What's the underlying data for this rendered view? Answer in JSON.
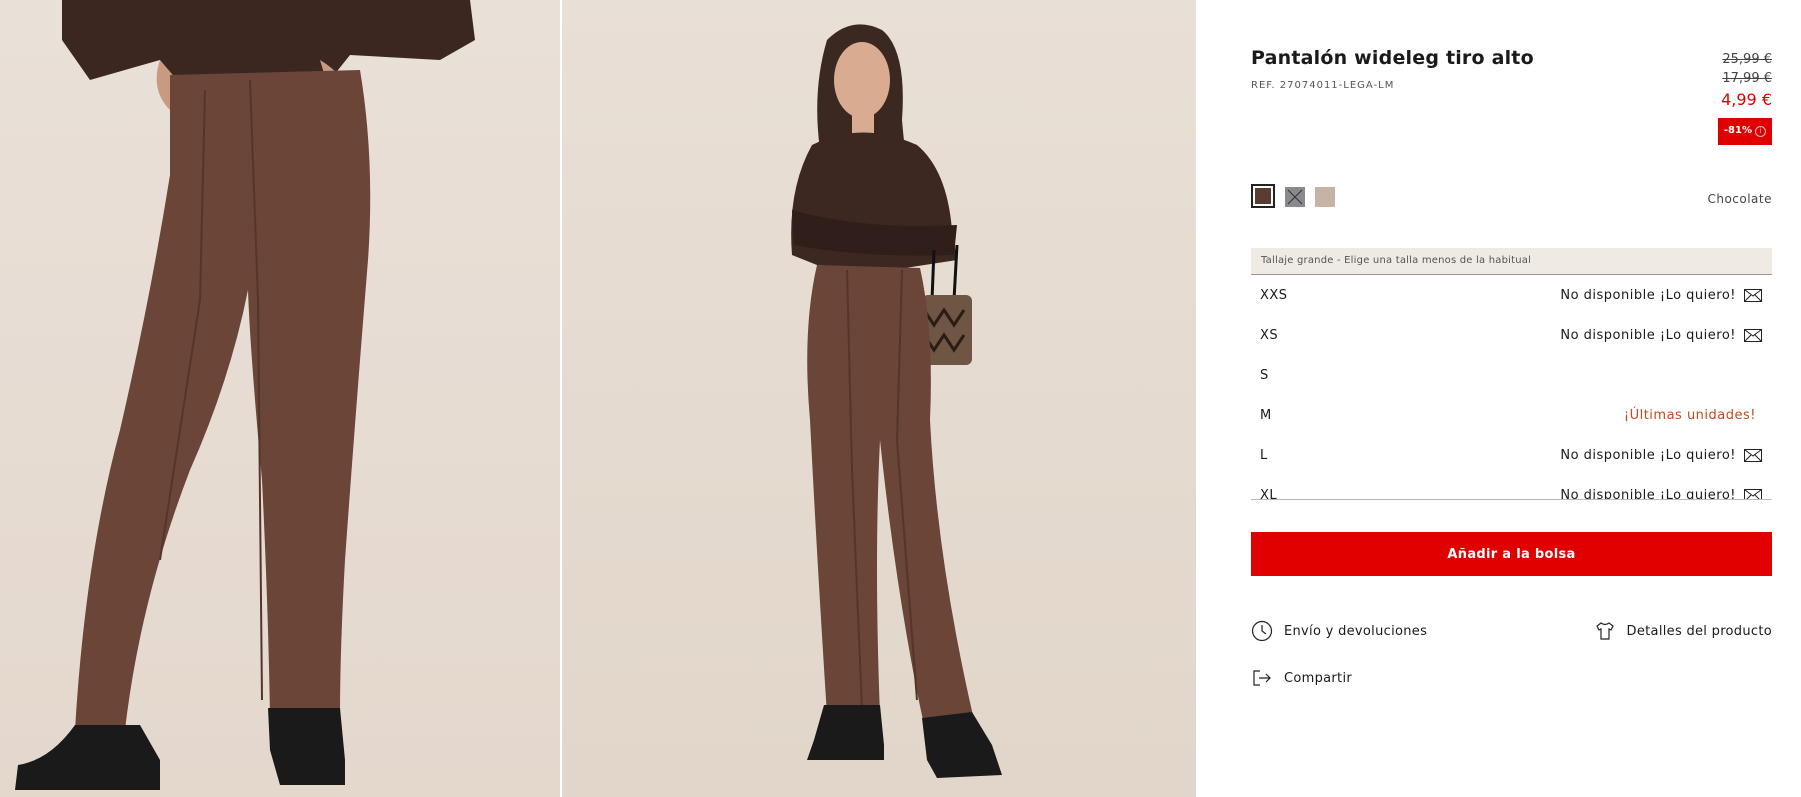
{
  "product": {
    "title": "Pantalón wideleg tiro alto",
    "ref": "REF. 27074011-LEGA-LM",
    "prices": {
      "original": "25,99 €",
      "previous": "17,99 €",
      "current": "4,99 €",
      "discount": "-81%"
    }
  },
  "colors": {
    "selected_name": "Chocolate",
    "swatches": [
      {
        "name": "chocolate",
        "hex": "#5a3c32",
        "available": true,
        "selected": true
      },
      {
        "name": "grey",
        "hex": "#8a8a8e",
        "available": false,
        "selected": false
      },
      {
        "name": "beige",
        "hex": "#c7b3a3",
        "available": true,
        "selected": false
      }
    ]
  },
  "sizes": {
    "note": "Tallaje grande - Elige una talla menos de la habitual",
    "rows": [
      {
        "label": "XXS",
        "status": "No disponible ¡Lo quiero!"
      },
      {
        "label": "XS",
        "status": "No disponible ¡Lo quiero!"
      },
      {
        "label": "S",
        "status": ""
      },
      {
        "label": "M",
        "status": "¡Últimas unidades!"
      },
      {
        "label": "L",
        "status": "No disponible ¡Lo quiero!"
      },
      {
        "label": "XL",
        "status": "No disponible ¡Lo quiero!"
      }
    ]
  },
  "actions": {
    "add_to_bag": "Añadir a la bolsa",
    "shipping": "Envío y devoluciones",
    "details": "Detalles del producto",
    "share": "Compartir"
  },
  "theme": {
    "accent": "#e00000",
    "warning": "#c24a1c"
  }
}
